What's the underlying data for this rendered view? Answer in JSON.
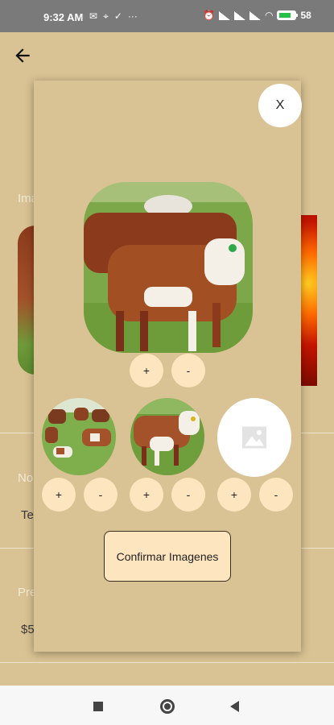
{
  "status_bar": {
    "time": "9:32 AM",
    "notification_icons": [
      "mail-icon",
      "location-icon",
      "check-download-icon",
      "more-dots-icon"
    ],
    "more_label": "···",
    "battery_percent": "58"
  },
  "background": {
    "label_images": "Ima",
    "label_name": "No",
    "value_name": "Te",
    "label_price": "Pre",
    "value_price": "$5"
  },
  "modal": {
    "close_label": "X",
    "main_photo": {
      "plus_label": "+",
      "minus_label": "-"
    },
    "thumbnails": [
      {
        "plus_label": "+",
        "minus_label": "-"
      },
      {
        "plus_label": "+",
        "minus_label": "-"
      },
      {
        "plus_label": "+",
        "minus_label": "-"
      }
    ],
    "confirm_label": "Confirmar Imagenes"
  },
  "colors": {
    "background": "#d9c293",
    "button": "#fde5bf",
    "status_bar": "#7a7a7a",
    "nav_bar": "#f7f7f7"
  }
}
